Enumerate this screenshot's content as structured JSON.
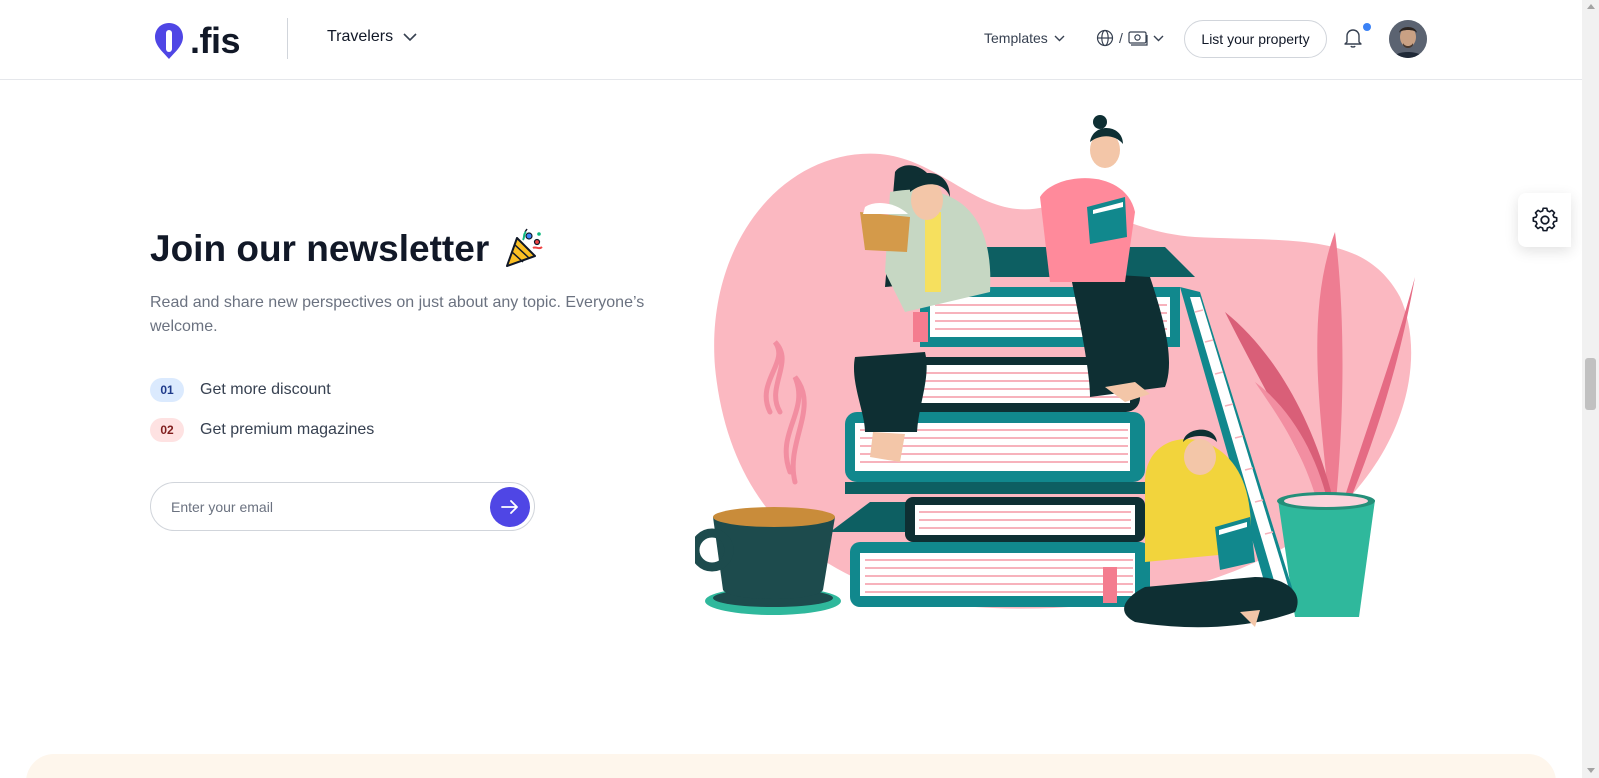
{
  "header": {
    "logo_text": ".fis",
    "menu_label": "Travelers",
    "templates_label": "Templates",
    "lang_separator": "/",
    "list_property_label": "List your property",
    "notification_dot_color": "#3b82f6"
  },
  "newsletter": {
    "title": "Join our newsletter",
    "description": "Read and share new perspectives on just about any topic. Everyone’s welcome.",
    "features": [
      {
        "num": "01",
        "label": "Get more discount"
      },
      {
        "num": "02",
        "label": "Get premium magazines"
      }
    ],
    "email_placeholder": "Enter your email"
  },
  "colors": {
    "accent": "#4f46e5",
    "illustration_pink": "#fbb8c1",
    "teal": "#0f7f85"
  }
}
